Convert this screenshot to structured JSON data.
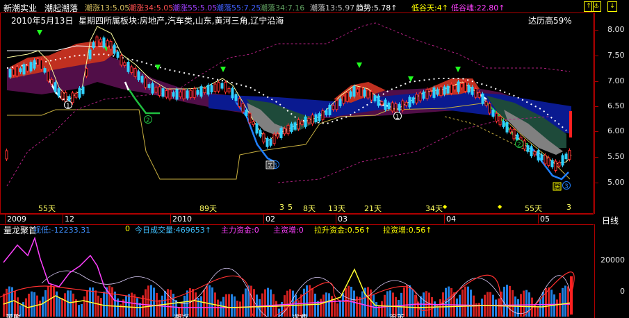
{
  "header": {
    "stock_name": "新潮实业",
    "indicator": "潮起潮落",
    "items": [
      {
        "text": "潮涨13:5.05",
        "color": "#d8c060"
      },
      {
        "text": "潮涨34:5.05",
        "color": "#ff5050"
      },
      {
        "text": "潮涨55:5.05",
        "color": "#a040ff"
      },
      {
        "text": "潮落55:7.25",
        "color": "#4060ff"
      },
      {
        "text": "潮落34:7.16",
        "color": "#60a060"
      },
      {
        "text": "潮落13:5.97",
        "color": "#c0c0c0"
      },
      {
        "text": "趋势:5.78↑",
        "color": "#ffffff"
      },
      {
        "text": "低谷天:4↑",
        "color": "#ffff00"
      },
      {
        "text": "低谷魂:22.80↑",
        "color": "#ff40ff"
      }
    ]
  },
  "info_line": {
    "date": "2010年5月13日",
    "detail": "星期四所属板块:房地产,汽车类,山东,黄河三角,辽宁沿海",
    "high_pct": "达历高59%"
  },
  "price_axis": [
    "8.00",
    "7.50",
    "7.00",
    "6.50",
    "6.00",
    "5.50",
    "5.00"
  ],
  "price_range": [
    4.6,
    8.2
  ],
  "day_labels": [
    "55天",
    "89天",
    "3",
    "5",
    "8天",
    "13天",
    "21天",
    "34天",
    "55天",
    "3"
  ],
  "markers": {
    "dot": "◆",
    "circle_1": "①",
    "circle_2": "②",
    "circle_3": "③",
    "ju": "居"
  },
  "date_axis": [
    "2009",
    "12",
    "2010",
    "02",
    "03",
    "04",
    "05"
  ],
  "period": "日线",
  "sub_panel": {
    "title": "量龙聚首",
    "items": [
      {
        "text": "视低:-12233.31",
        "color": "#4090ff"
      },
      {
        "text": "0",
        "color": "#ffff00"
      },
      {
        "text": "今日成交量:469653↑",
        "color": "#40c0ff"
      },
      {
        "text": "主力资金:0",
        "color": "#ff40ff"
      },
      {
        "text": "主资增:0",
        "color": "#ff40ff"
      },
      {
        "text": "拉升资金:0.56↑",
        "color": "#ffff00"
      },
      {
        "text": "拉资增:0.56↑",
        "color": "#ffff00"
      }
    ],
    "axis": [
      "20000",
      "0"
    ]
  },
  "bottom_labels": [
    "量能",
    "潮汐",
    "流通",
    "资金"
  ],
  "toolbar": {
    "up": "↑",
    "down": "↓",
    "anchor": "⚓"
  }
}
